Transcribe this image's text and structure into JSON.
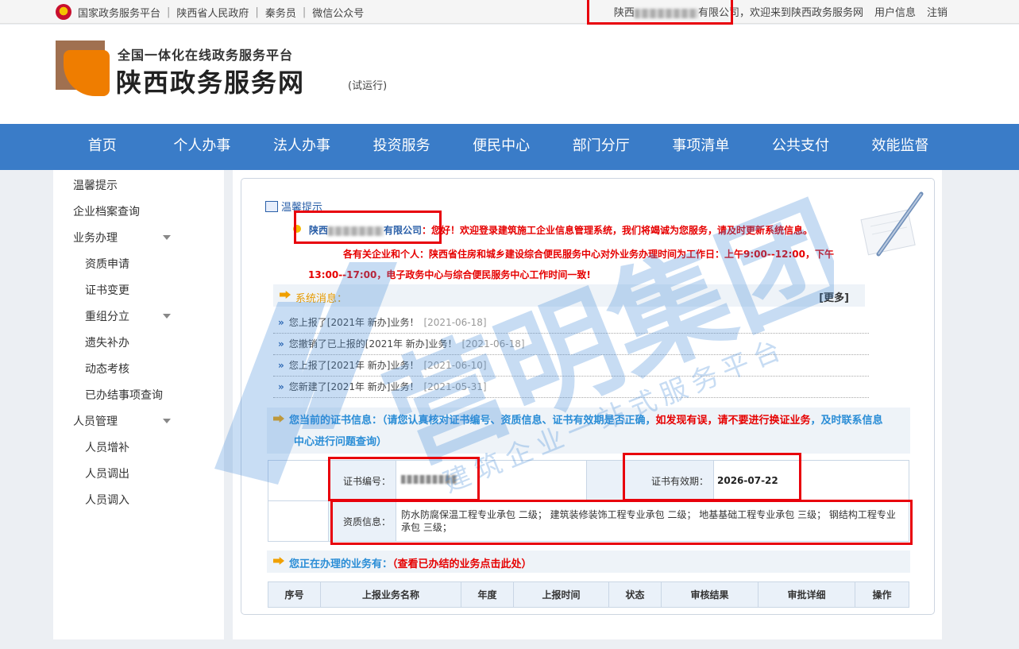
{
  "topbar": {
    "links": [
      "国家政务服务平台",
      "陕西省人民政府",
      "秦务员",
      "微信公众号"
    ],
    "separator": "|",
    "company_prefix": "陕西",
    "company_suffix": "有限公司",
    "welcome": "，欢迎来到陕西政务服务网",
    "user_info": "用户信息",
    "logout": "注销"
  },
  "header": {
    "subtitle": "全国一体化在线政务服务平台",
    "title": "陕西政务服务网",
    "trial": "(试运行)"
  },
  "nav": [
    "首页",
    "个人办事",
    "法人办事",
    "投资服务",
    "便民中心",
    "部门分厅",
    "事项清单",
    "公共支付",
    "效能监督"
  ],
  "sidebar": [
    {
      "label": "温馨提示",
      "sub": false,
      "caret": false
    },
    {
      "label": "企业档案查询",
      "sub": false,
      "caret": false
    },
    {
      "label": "业务办理",
      "sub": false,
      "caret": true
    },
    {
      "label": "资质申请",
      "sub": true,
      "caret": false
    },
    {
      "label": "证书变更",
      "sub": true,
      "caret": false
    },
    {
      "label": "重组分立",
      "sub": true,
      "caret": true
    },
    {
      "label": "遗失补办",
      "sub": true,
      "caret": false
    },
    {
      "label": "动态考核",
      "sub": true,
      "caret": false
    },
    {
      "label": "已办结事项查询",
      "sub": true,
      "caret": false
    },
    {
      "label": "人员管理",
      "sub": false,
      "caret": true
    },
    {
      "label": "人员增补",
      "sub": true,
      "caret": false
    },
    {
      "label": "人员调出",
      "sub": true,
      "caret": false
    },
    {
      "label": "人员调入",
      "sub": true,
      "caret": false
    }
  ],
  "tip": {
    "title": "温馨提示",
    "company_prefix": "陕西",
    "company_suffix": "有限公司",
    "greeting": "：您好！欢迎登录建筑施工企业信息管理系统，我们将竭诚为您服务，请及时更新系统信息。",
    "notice": "各有关企业和个人：陕西省住房和城乡建设综合便民服务中心对外业务办理时间为工作日：上午9:00--12:00，下午13:00--17:00，电子政务中心与综合便民服务中心工作时间一致!"
  },
  "system_messages": {
    "title": "系统消息：",
    "more": "[更多]",
    "items": [
      {
        "text": "您上报了[2021年 新办]业务！",
        "date": "[2021-06-18]"
      },
      {
        "text": "您撤销了已上报的[2021年 新办]业务！",
        "date": "[2021-06-18]"
      },
      {
        "text": "您上报了[2021年 新办]业务！",
        "date": "[2021-06-10]"
      },
      {
        "text": "您新建了[2021年 新办]业务！",
        "date": "[2021-05-31]"
      }
    ]
  },
  "certificate": {
    "heading_a": "您当前的证书信息：（请您认真核对证书编号、资质信息、证书有效期是否正确，",
    "heading_red": "如发现有误，请不要进行换证业务",
    "heading_b": "，及时联系信息",
    "heading_c": "中心进行问题查询）",
    "number_label": "证书编号：",
    "validity_label": "证书有效期：",
    "validity_value": "2026-07-22",
    "qualification_label": "资质信息：",
    "qualification_value": "防水防腐保温工程专业承包 二级； 建筑装修装饰工程专业承包 二级； 地基基础工程专业承包 三级； 钢结构工程专业承包 三级；"
  },
  "business": {
    "heading": "您正在办理的业务有：",
    "link": "（查看已办结的业务点击此处）",
    "columns": [
      "序号",
      "上报业务名称",
      "年度",
      "上报时间",
      "状态",
      "审核结果",
      "审批详细",
      "操作"
    ]
  },
  "watermark": {
    "main": "营明集团",
    "sub": "建筑企业一站式服务平台"
  },
  "colors": {
    "nav_bg": "#3a7cc8",
    "highlight_red": "#e8000b",
    "accent_blue": "#2a8dd6",
    "warning_red": "#e60000"
  }
}
